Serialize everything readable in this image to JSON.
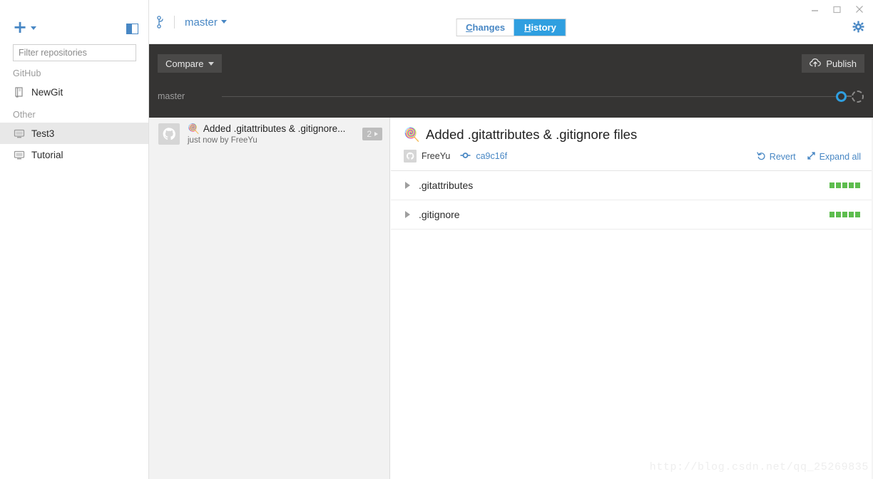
{
  "window": {
    "controls": [
      {
        "name": "minimize",
        "glyph": "—"
      },
      {
        "name": "maximize",
        "glyph": "☐"
      },
      {
        "name": "close",
        "glyph": "✕"
      }
    ]
  },
  "sidebar": {
    "add_button": {
      "label": "+",
      "icon": "plus-icon"
    },
    "panel_toggle": {
      "icon": "sidebar-toggle-icon"
    },
    "filter": {
      "placeholder": "Filter repositories",
      "value": ""
    },
    "groups": [
      {
        "label": "GitHub",
        "items": [
          {
            "name": "NewGit",
            "icon": "repo-book-icon",
            "selected": false
          }
        ]
      },
      {
        "label": "Other",
        "items": [
          {
            "name": "Test3",
            "icon": "repo-local-icon",
            "selected": true
          },
          {
            "name": "Tutorial",
            "icon": "repo-local-icon",
            "selected": false
          }
        ]
      }
    ]
  },
  "titlebar": {
    "branch_icon": "git-branch-icon",
    "branch": "master",
    "tabs": [
      {
        "label": "Changes",
        "accel": "C",
        "rest": "hanges",
        "active": false
      },
      {
        "label": "History",
        "accel": "H",
        "rest": "istory",
        "active": true
      }
    ],
    "settings_icon": "gear-icon"
  },
  "toolbar": {
    "compare": {
      "label": "Compare",
      "icon": "chevron-down-icon"
    },
    "publish": {
      "label": "Publish",
      "icon": "cloud-upload-icon"
    },
    "timeline": {
      "branch_label": "master",
      "current_dot": "commit-dot",
      "pending_dot": "pending-dot"
    }
  },
  "commit_list": [
    {
      "emoji": "🍭",
      "title": "Added .gitattributes & .gitignore...",
      "subtitle": "just now by FreeYu",
      "badge": "2",
      "avatar": "octocat-avatar",
      "selected": false
    }
  ],
  "detail": {
    "emoji": "🍭",
    "title": "Added .gitattributes & .gitignore files",
    "author": "FreeYu",
    "author_avatar": "octocat-avatar",
    "sha": "ca9c16f",
    "sha_icon": "commit-node-icon",
    "actions": [
      {
        "label": "Revert",
        "icon": "revert-icon"
      },
      {
        "label": "Expand all",
        "icon": "expand-icon"
      }
    ],
    "files": [
      {
        "name": ".gitattributes",
        "diff_blocks": 5,
        "diff_color": "#5dbd4e",
        "expanded": false
      },
      {
        "name": ".gitignore",
        "diff_blocks": 5,
        "diff_color": "#5dbd4e",
        "expanded": false
      }
    ]
  },
  "watermark": "http://blog.csdn.net/qq_25269835",
  "colors": {
    "accent_blue": "#4887c4",
    "tab_active": "#2f9fe0",
    "dark_toolbar": "#353433",
    "list_bg": "#f2f2f2",
    "diff_green": "#5dbd4e"
  }
}
